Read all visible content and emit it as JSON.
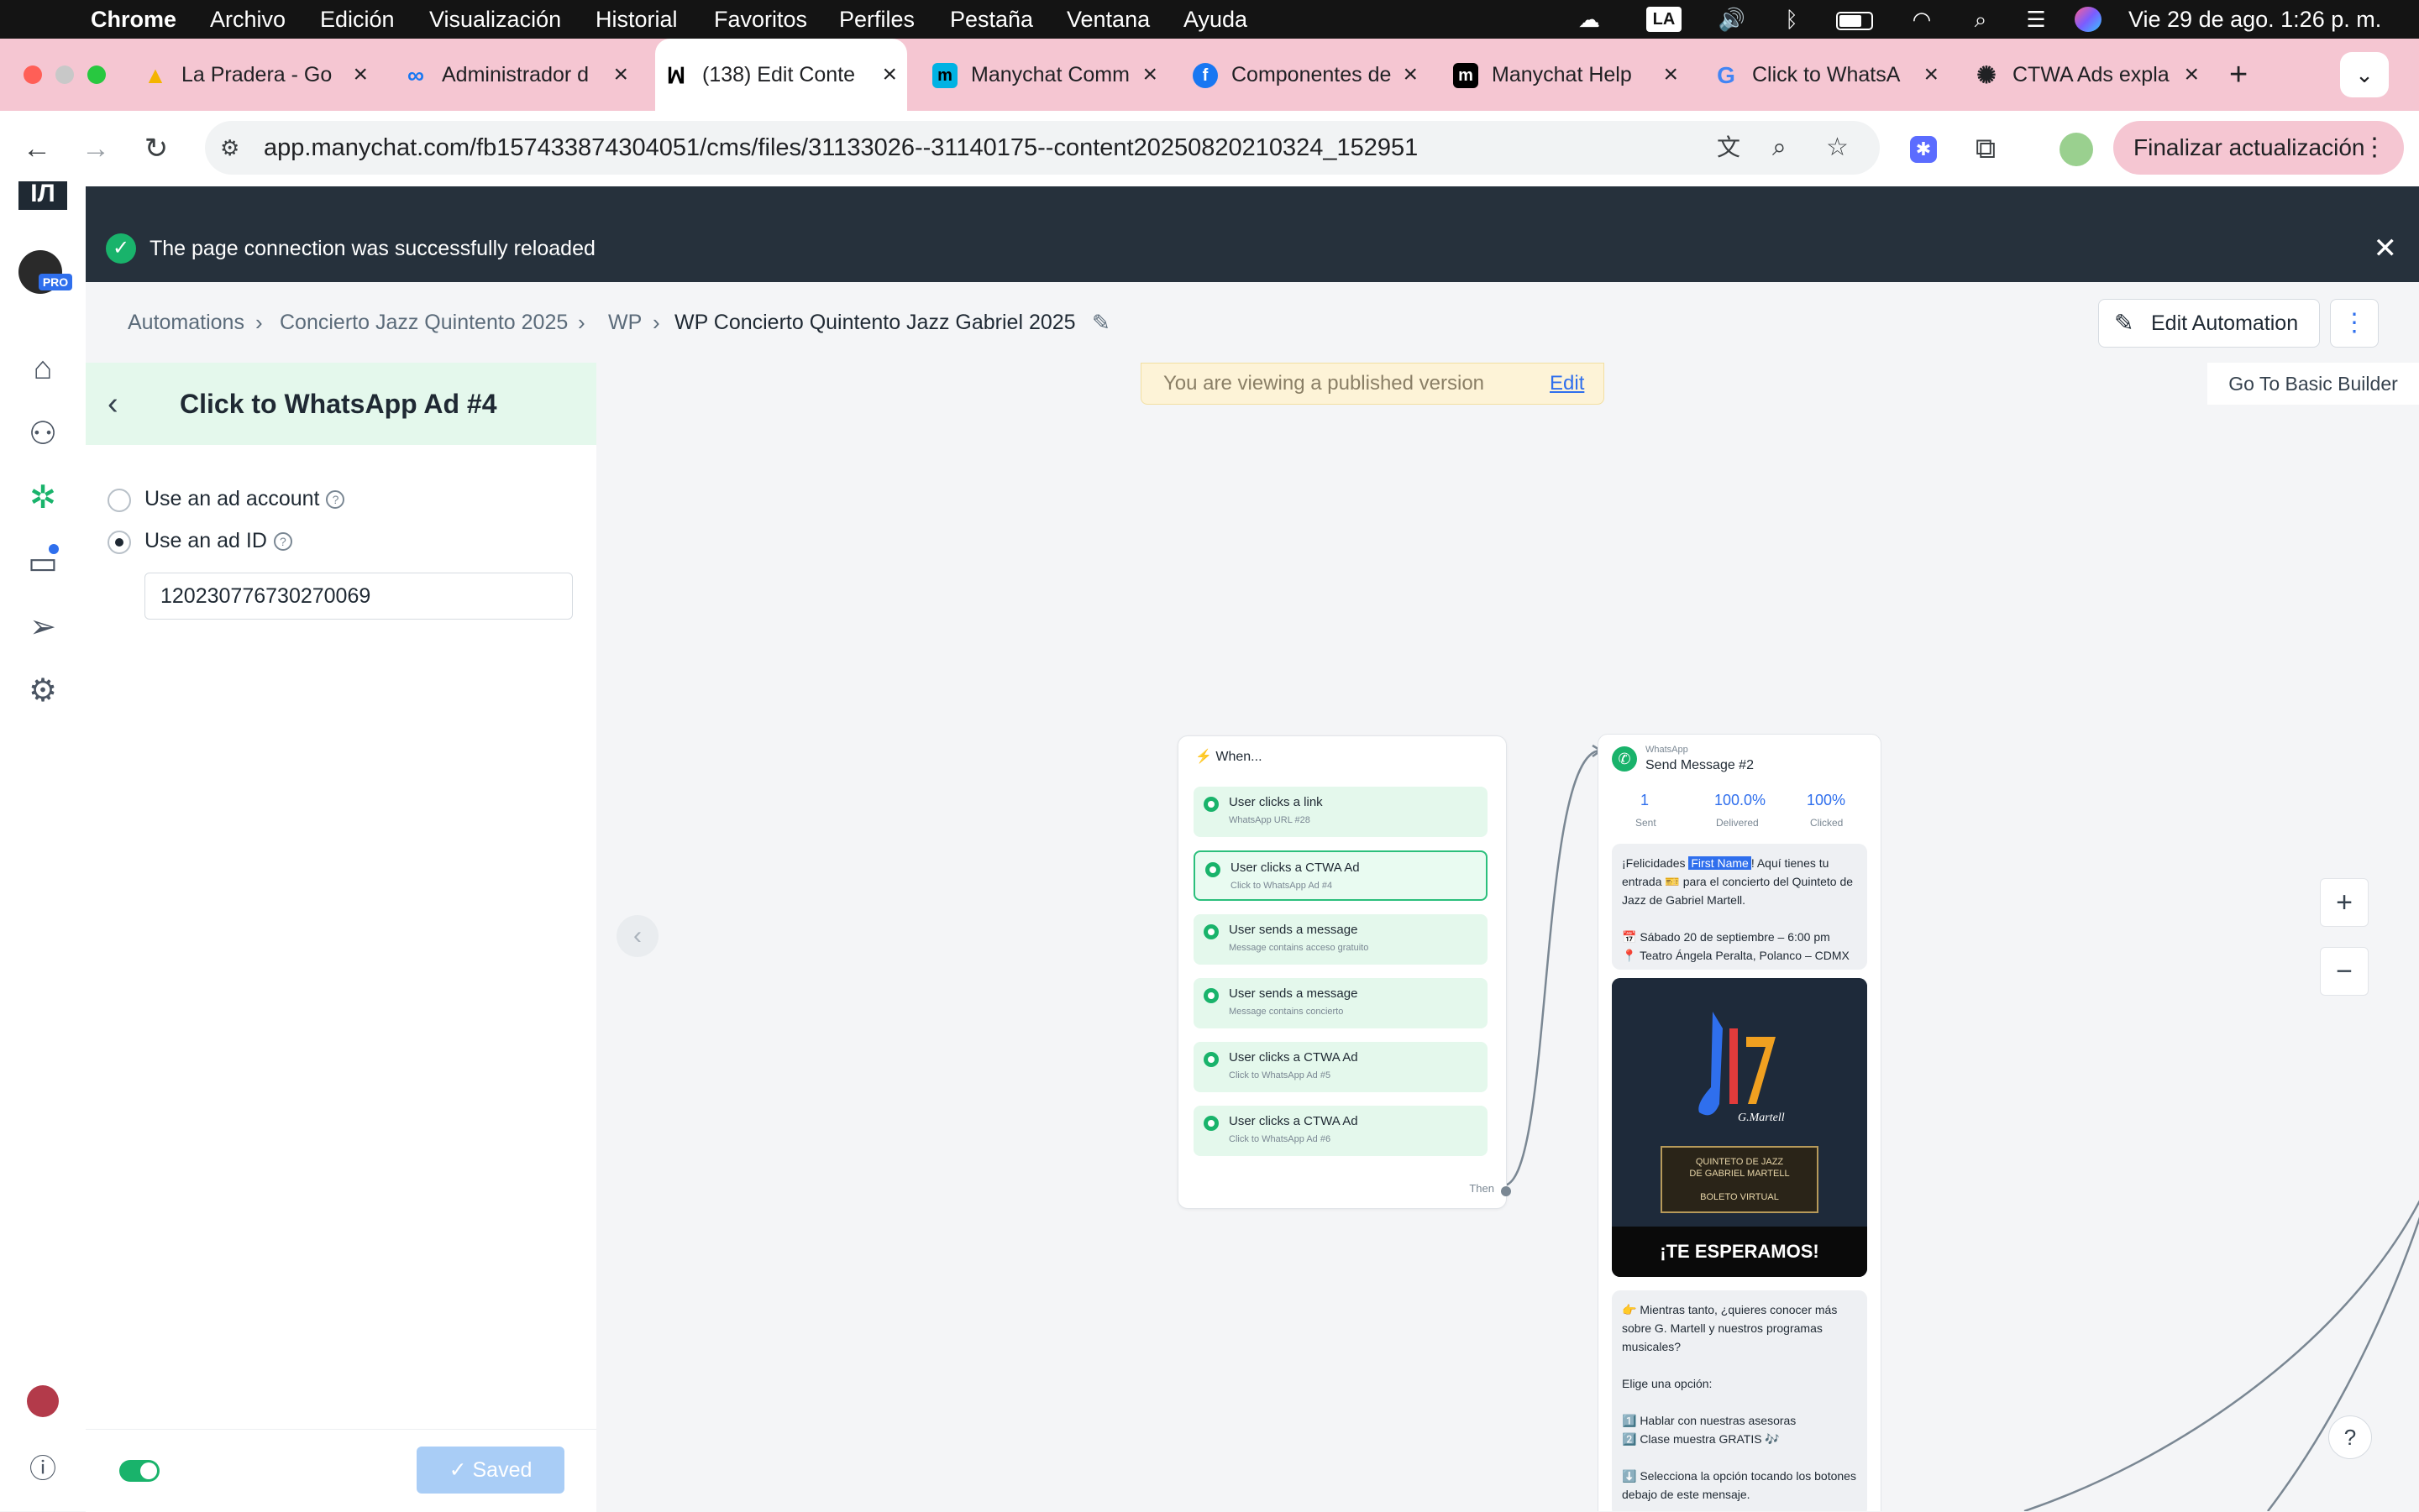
{
  "menubar": {
    "app_name": "Chrome",
    "menus": [
      "Archivo",
      "Edición",
      "Visualización",
      "Historial",
      "Favoritos",
      "Perfiles",
      "Pestaña",
      "Ventana",
      "Ayuda"
    ],
    "input_source": "LA",
    "datetime": "Vie 29 de ago.  1:26 p. m."
  },
  "tabs": [
    {
      "title": "La Pradera - Go",
      "icon": "google-drive-icon",
      "color": "#f4b400"
    },
    {
      "title": "Administrador d",
      "icon": "meta-icon",
      "color": "#1877f2"
    },
    {
      "title": "(138) Edit Conte",
      "icon": "manychat-icon",
      "color": "#000000",
      "active": true
    },
    {
      "title": "Manychat Comm",
      "icon": "manychat-icon",
      "color": "#00b2e3"
    },
    {
      "title": "Componentes de",
      "icon": "facebook-icon",
      "color": "#1877f2"
    },
    {
      "title": "Manychat Help",
      "icon": "manychat-icon",
      "color": "#000000"
    },
    {
      "title": "Click to WhatsA",
      "icon": "google-icon",
      "color": "#4285f4"
    },
    {
      "title": "CTWA Ads expla",
      "icon": "openai-icon",
      "color": "#202124"
    }
  ],
  "address": {
    "url": "app.manychat.com/fb157433874304051/cms/files/31133026--31140175--content20250820210324_152951",
    "update_label": "Finalizar actualización"
  },
  "banner": {
    "message": "The page connection was successfully reloaded"
  },
  "breadcrumb": {
    "items": [
      "Automations",
      "Concierto Jazz Quintento 2025",
      "WP",
      "WP Concierto Quintento Jazz Gabriel 2025"
    ],
    "edit_automation_label": "Edit Automation"
  },
  "panel": {
    "title": "Click to WhatsApp Ad #4",
    "option_account": "Use an ad account",
    "option_adid": "Use an ad ID",
    "selected": "adid",
    "ad_id_value": "120230776730270069",
    "saved_label": "Saved",
    "toggle_on": true
  },
  "canvas": {
    "published_notice": "You are viewing a published version",
    "published_edit": "Edit",
    "basic_builder": "Go To Basic Builder"
  },
  "trigger_card": {
    "header": "When...",
    "items": [
      {
        "title": "User clicks a link",
        "sub": "WhatsApp URL #28"
      },
      {
        "title": "User clicks a CTWA Ad",
        "sub": "Click to WhatsApp Ad #4",
        "selected": true
      },
      {
        "title": "User sends a message",
        "sub": "Message contains acceso gratuito"
      },
      {
        "title": "User sends a message",
        "sub": "Message contains concierto"
      },
      {
        "title": "User clicks a CTWA Ad",
        "sub": "Click to WhatsApp Ad #5"
      },
      {
        "title": "User clicks a CTWA Ad",
        "sub": "Click to WhatsApp Ad #6"
      }
    ],
    "then_label": "Then"
  },
  "message_card": {
    "channel": "WhatsApp",
    "title": "Send Message #2",
    "stats": [
      {
        "value": "1",
        "label": "Sent"
      },
      {
        "value": "100.0%",
        "label": "Delivered"
      },
      {
        "value": "100%",
        "label": "Clicked"
      }
    ],
    "bubble1": {
      "before": "¡Felicidades ",
      "tag": "First Name",
      "after": "! Aquí tienes tu entrada 🎫 para el concierto del Quinteto de Jazz de Gabriel Martell.",
      "date_line": "📅 Sábado 20 de septiembre – 6:00 pm",
      "place_line": "📍 Teatro Ángela Peralta, Polanco – CDMX"
    },
    "image": {
      "ticket_title": "QUINTETO DE JAZZ",
      "ticket_sub": "DE GABRIEL MARTELL",
      "ticket_foot": "BOLETO VIRTUAL",
      "caption": "¡TE ESPERAMOS!"
    },
    "bubble2": {
      "line1": "👉 Mientras tanto, ¿quieres conocer más sobre G. Martell y nuestros programas musicales?",
      "line2": "Elige una opción:",
      "line3": "1️⃣ Hablar con nuestras asesoras",
      "line4": "2️⃣ Clase muestra GRATIS 🎶",
      "line5": "⬇️ Selecciona la opción tocando los botones debajo de este mensaje."
    }
  },
  "colors": {
    "accent_green": "#19b36b",
    "link_blue": "#2f6fed",
    "tab_strip": "#f5c6d2",
    "banner_dark": "#26313c"
  }
}
